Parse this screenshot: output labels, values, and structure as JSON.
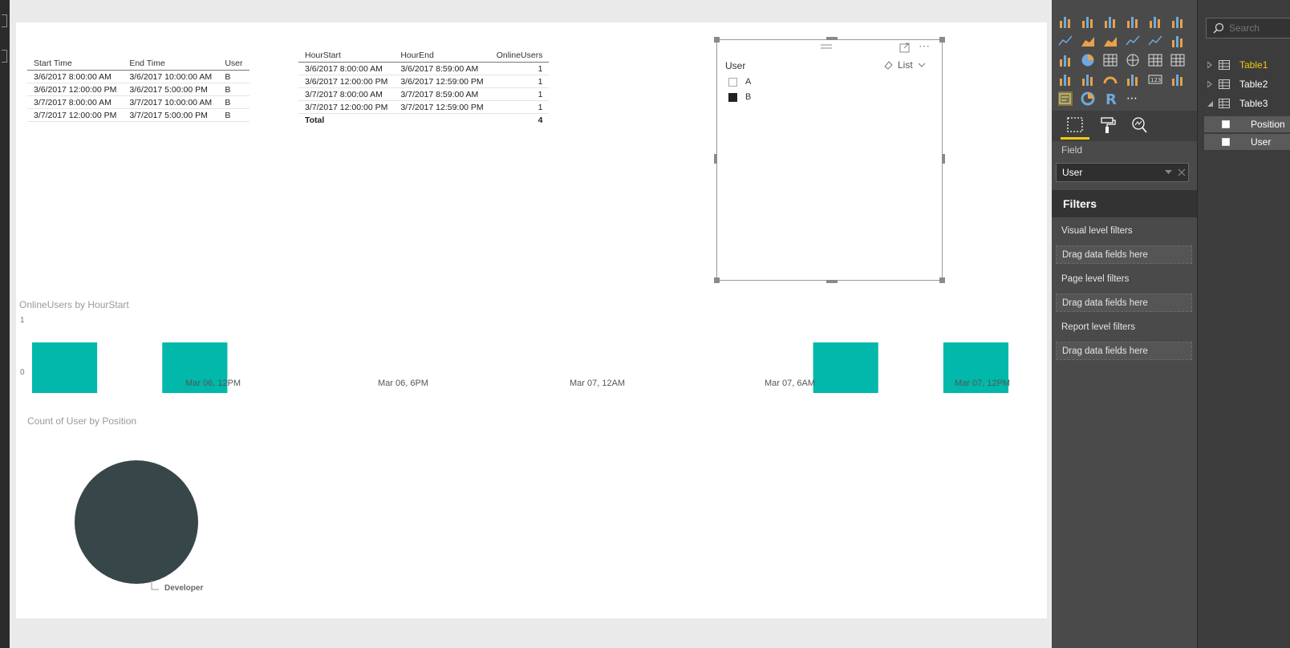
{
  "table1": {
    "headers": [
      "Start Time",
      "End Time",
      "User"
    ],
    "rows": [
      [
        "3/6/2017 8:00:00 AM",
        "3/6/2017 10:00:00 AM",
        "B"
      ],
      [
        "3/6/2017 12:00:00 PM",
        "3/6/2017 5:00:00 PM",
        "B"
      ],
      [
        "3/7/2017 8:00:00 AM",
        "3/7/2017 10:00:00 AM",
        "B"
      ],
      [
        "3/7/2017 12:00:00 PM",
        "3/7/2017 5:00:00 PM",
        "B"
      ]
    ]
  },
  "table2": {
    "headers": [
      "HourStart",
      "HourEnd",
      "OnlineUsers"
    ],
    "rows": [
      [
        "3/6/2017 8:00:00 AM",
        "3/6/2017 8:59:00 AM",
        "1"
      ],
      [
        "3/6/2017 12:00:00 PM",
        "3/6/2017 12:59:00 PM",
        "1"
      ],
      [
        "3/7/2017 8:00:00 AM",
        "3/7/2017 8:59:00 AM",
        "1"
      ],
      [
        "3/7/2017 12:00:00 PM",
        "3/7/2017 12:59:00 PM",
        "1"
      ]
    ],
    "total_label": "Total",
    "total_value": "4"
  },
  "slicer": {
    "title": "User",
    "mode_label": "List",
    "items": [
      {
        "label": "A",
        "checked": false
      },
      {
        "label": "B",
        "checked": true
      }
    ]
  },
  "colors": {
    "teal": "#01b8aa",
    "pie": "#374649",
    "pane_bg": "#4a4a4a",
    "fields_bg": "#3c3c3c",
    "active_table": "#f2c811"
  },
  "chart_data": [
    {
      "type": "bar",
      "title": "OnlineUsers by HourStart",
      "xlabel": "",
      "ylabel": "",
      "yticks": [
        "1",
        "0"
      ],
      "ylim": [
        0,
        1
      ],
      "x_tick_labels": [
        "Mar 06, 12PM",
        "Mar 06, 6PM",
        "Mar 07, 12AM",
        "Mar 07, 6AM",
        "Mar 07, 12PM"
      ],
      "series": [
        {
          "values": [
            {
              "start": "2017-03-06 08:00",
              "end": "2017-03-06 10:00",
              "y": 1
            },
            {
              "start": "2017-03-06 12:00",
              "end": "2017-03-06 14:00",
              "y": 1
            },
            {
              "start": "2017-03-07 08:00",
              "end": "2017-03-07 10:00",
              "y": 1
            },
            {
              "start": "2017-03-07 12:00",
              "end": "2017-03-07 14:00",
              "y": 1
            }
          ]
        }
      ],
      "color": "#01b8aa"
    },
    {
      "type": "pie",
      "title": "Count of User by Position",
      "slices": [
        {
          "label": "Developer",
          "value": 1
        }
      ],
      "color": "#374649"
    }
  ],
  "viz_pane": {
    "icons": [
      "stacked-bar-icon",
      "stacked-column-icon",
      "clustered-bar-icon",
      "clustered-column-icon",
      "100-bar-icon",
      "100-column-icon",
      "line-chart-icon",
      "area-chart-icon",
      "stacked-area-icon",
      "line-column-icon",
      "line-clustered-column-icon",
      "ribbon-chart-icon",
      "scatter-icon",
      "pie-chart-icon",
      "treemap-icon",
      "map-icon",
      "table-icon",
      "matrix-icon",
      "waterfall-icon",
      "funnel-icon",
      "gauge-icon",
      "multi-row-card-icon",
      "card-icon",
      "kpi-icon",
      "slicer-icon",
      "donut-icon",
      "r-visual-icon",
      "more-visuals-icon"
    ],
    "tabs": [
      "fields-tab-icon",
      "format-tab-icon",
      "analytics-tab-icon"
    ],
    "field_label": "Field",
    "field_value": "User",
    "filters_title": "Filters",
    "sections": [
      {
        "title": "Visual level filters",
        "drop": "Drag data fields here"
      },
      {
        "title": "Page level filters",
        "drop": "Drag data fields here"
      },
      {
        "title": "Report level filters",
        "drop": "Drag data fields here"
      }
    ]
  },
  "fields_pane": {
    "search_placeholder": "Search",
    "tables": [
      {
        "name": "Table1",
        "expanded": false,
        "active": true
      },
      {
        "name": "Table2",
        "expanded": false,
        "active": false
      },
      {
        "name": "Table3",
        "expanded": true,
        "active": false
      }
    ],
    "fields": [
      "Position",
      "User"
    ]
  }
}
